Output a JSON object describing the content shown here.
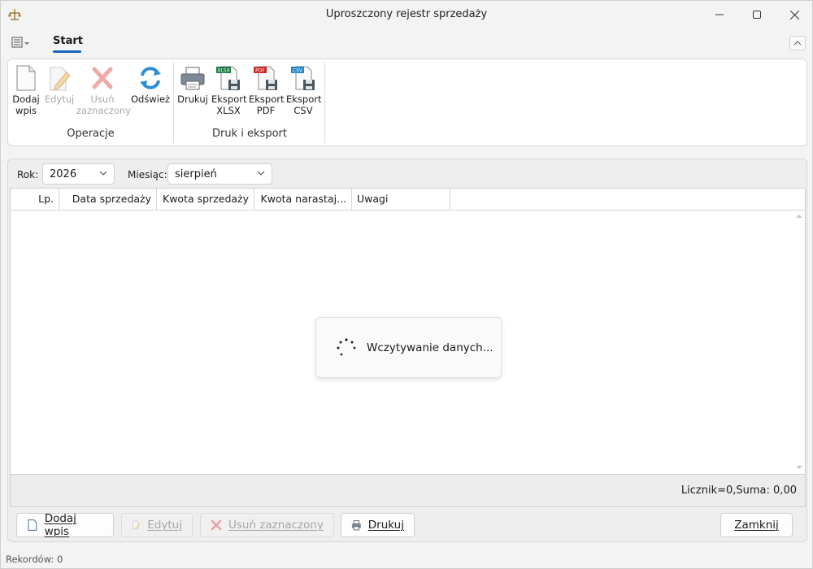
{
  "window": {
    "title": "Uproszczony rejestr sprzedaży"
  },
  "ribbon": {
    "tab": "Start",
    "groups": [
      {
        "label": "Operacje"
      },
      {
        "label": "Druk i eksport"
      }
    ],
    "buttons": {
      "add": {
        "line1": "Dodaj",
        "line2": "wpis"
      },
      "edit": {
        "line1": "Edytuj"
      },
      "delete": {
        "line1": "Usuń",
        "line2": "zaznaczony"
      },
      "refresh": {
        "line1": "Odśwież"
      },
      "print": {
        "line1": "Drukuj"
      },
      "xlsx": {
        "line1": "Eksport",
        "line2": "XLSX",
        "badge": "XLSX"
      },
      "pdf": {
        "line1": "Eksport",
        "line2": "PDF",
        "badge": "PDF"
      },
      "csv": {
        "line1": "Eksport",
        "line2": "CSV",
        "badge": "CSV"
      }
    }
  },
  "filters": {
    "year_label": "Rok:",
    "year_value": "2026",
    "month_label": "Miesiąc:",
    "month_value": "sierpień"
  },
  "table": {
    "columns": [
      "Lp.",
      "Data sprzedaży",
      "Kwota sprzedaży",
      "Kwota narastaj...",
      "Uwagi"
    ]
  },
  "loading_text": "Wczytywanie danych...",
  "summary": "Licznik=0,Suma: 0,00",
  "buttons": {
    "add": "Dodaj wpis",
    "edit": "Edytuj",
    "delete": "Usuń zaznaczony",
    "print": "Drukuj",
    "close": "Zamknij"
  },
  "status": "Rekordów: 0",
  "colors": {
    "accent": "#1565c0",
    "delete_red": "#e08a8a",
    "xlsx_green": "#1d7a45",
    "pdf_red": "#c62828",
    "csv_blue": "#1e88c7"
  }
}
